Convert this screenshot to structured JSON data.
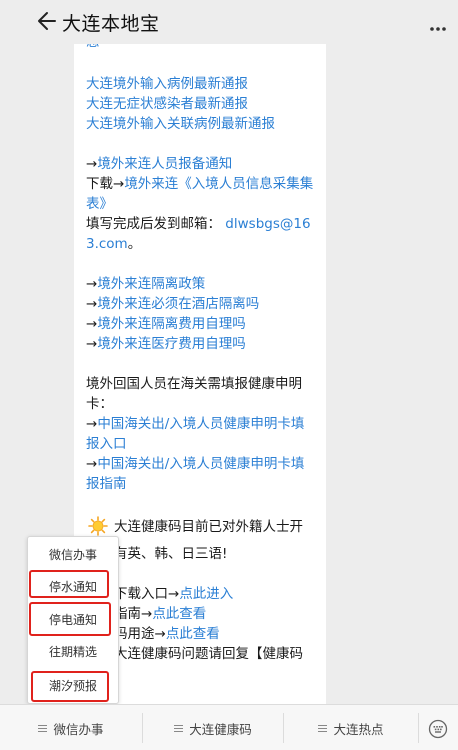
{
  "header": {
    "title": "大连本地宝"
  },
  "message": {
    "top_fragment": "态",
    "links_group1": [
      "大连境外输入病例最新通报",
      "大连无症状感染者最新通报",
      "大连境外输入关联病例最新通报"
    ],
    "report": {
      "arrow": "→",
      "notice_link": "境外来连人员报备通知",
      "download_prefix": "下载→",
      "form_link_line1": "境外来连《入境人员信息采集集",
      "form_link_line2": "表》",
      "email_prefix": "填写完成后发到邮箱：",
      "email_line1": "dlwsbgs@16",
      "email_line2": "3.com",
      "email_suffix": "。"
    },
    "links_group2": [
      "境外来连隔离政策",
      "境外来连必须在酒店隔离吗",
      "境外来连隔离费用自理吗",
      "境外来连医疗费用自理吗"
    ],
    "customs": {
      "text_line1": "境外回国人员在海关需填报健康申明",
      "text_line2": "卡：",
      "link1_line1": "中国海关出/入境人员健康申明卡填",
      "link1_line2": "报入口",
      "link2_line1": "中国海关出/入境人员健康申明卡填",
      "link2_line2": "报指南"
    },
    "healthcode": {
      "line1": "大连健康码目前已对外籍人士开",
      "line2": "有英、韩、日三语!",
      "line3_text": "下载入口→",
      "line3_link": "点此进入",
      "line4_text": "指南→",
      "line4_link": "点此查看",
      "line5_text": "码用途→",
      "line5_link": "点此查看",
      "line6": "大连健康码问题请回复【健康码"
    }
  },
  "popup_menu": {
    "items": [
      "微信办事",
      "停水通知",
      "停电通知",
      "往期精选",
      "潮汐预报"
    ]
  },
  "tabbar": {
    "tabs": [
      "微信办事",
      "大连健康码",
      "大连热点"
    ]
  },
  "colors": {
    "link": "#2b7fd4",
    "highlight_box": "#e0221c",
    "background": "#ededed"
  }
}
